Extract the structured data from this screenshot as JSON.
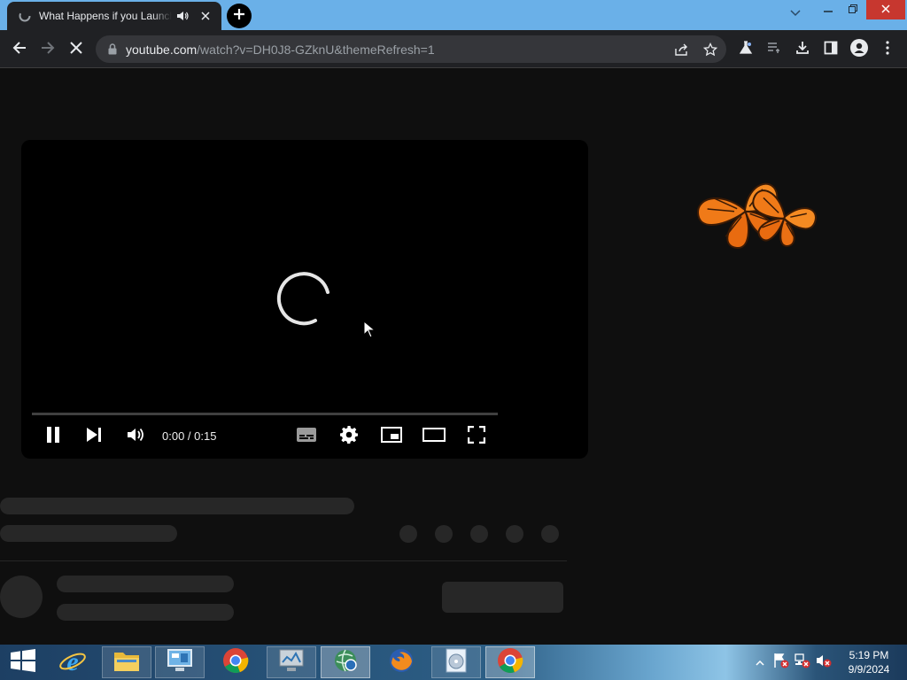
{
  "browser": {
    "tab": {
      "title": "What Happens if you Launch",
      "favicon": "youtube-loading-icon",
      "audio_icon": "speaker-icon",
      "close_icon": "close-icon"
    },
    "new_tab_icon": "plus-icon",
    "window_controls": [
      "tab-search-icon",
      "minimize-icon",
      "restore-icon",
      "close-icon"
    ],
    "toolbar": {
      "back_icon": "back-arrow-icon",
      "forward_icon": "forward-arrow-icon",
      "stop_icon": "stop-icon",
      "url_host": "youtube.com",
      "url_path": "/watch?v=DH0J8-GZknU&themeRefresh=1",
      "omnibox_icons": [
        "share-icon",
        "bookmark-star-icon"
      ],
      "right_icons": [
        "labs-flask-icon",
        "reading-list-icon",
        "download-icon",
        "side-panel-icon",
        "profile-icon",
        "menu-icon"
      ]
    }
  },
  "player": {
    "state": "loading",
    "time_display": "0:00 / 0:15",
    "progress": 0,
    "controls": [
      "pause-icon",
      "next-icon",
      "volume-icon",
      "subtitles-icon",
      "settings-gear-icon",
      "miniplayer-icon",
      "theater-mode-icon",
      "fullscreen-icon"
    ]
  },
  "colors": {
    "page_bg": "#0f0f0f",
    "skeleton": "#272727",
    "titlebar": "#6ab0e8",
    "chrome_dark": "#202124",
    "progress": "#ff0000"
  },
  "taskbar": {
    "start_icon": "windows-logo-icon",
    "apps": [
      "internet-explorer-icon",
      "file-explorer-icon",
      "control-panel-icon",
      "chrome-icon",
      "monitor-app-icon",
      "network-globe-icon",
      "firefox-icon",
      "media-disc-icon",
      "chrome-active-icon"
    ],
    "tray_icons": [
      "show-hidden-icons-icon",
      "flag-error-icon",
      "network-error-icon",
      "volume-muted-icon"
    ],
    "clock_time": "5:19 PM",
    "clock_date": "9/9/2024"
  }
}
